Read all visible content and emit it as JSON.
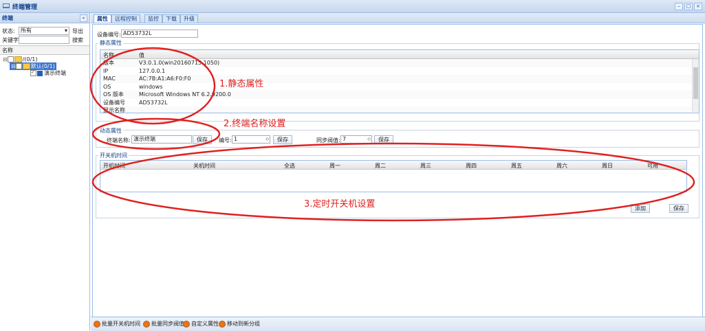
{
  "window": {
    "title": "终端管理",
    "buttons": [
      "–",
      "□",
      "×"
    ]
  },
  "left_panel": {
    "title": "终端",
    "status_label": "状态:",
    "status_value": "所有",
    "export_label": "导出",
    "keyword_label": "关键字:",
    "keyword_value": "",
    "search_label": "搜索",
    "tree_header": "名称",
    "tree_root": "/(0/1)",
    "tree_selected": "默认(0/1)",
    "tree_leaf": "演示终端"
  },
  "tabs": [
    "属性",
    "远程控制",
    "监控",
    "下载",
    "升级"
  ],
  "device": {
    "id_label": "设备编号:",
    "id_value": "AD53732L"
  },
  "static_props": {
    "legend": "静态属性",
    "col_name": "名称",
    "col_value": "值",
    "rows": [
      {
        "name": "版本",
        "value": "V3.0.1.0(win20160715.1050)"
      },
      {
        "name": "IP",
        "value": "127.0.0.1"
      },
      {
        "name": "MAC",
        "value": "AC:7B:A1:A6:F0:F0"
      },
      {
        "name": "OS",
        "value": "windows"
      },
      {
        "name": "OS 版本",
        "value": "Microsoft Windows NT 6.2.9200.0"
      },
      {
        "name": "设备编号",
        "value": "AD53732L"
      }
    ],
    "partial_row": "显示名称"
  },
  "dynamic_props": {
    "legend": "动态属性",
    "name_label": "终端名称:",
    "name_value": "演示终端",
    "save1": "保存",
    "num_label": "编号:",
    "num_value": "1",
    "save2": "保存",
    "sync_label": "同步阀值:",
    "sync_value": "7",
    "save3": "保存"
  },
  "schedule": {
    "legend": "开关机时间",
    "columns": [
      "开机时间",
      "关机时间",
      "全选",
      "周一",
      "周二",
      "周三",
      "周四",
      "周五",
      "周六",
      "周日",
      "可用"
    ],
    "add_label": "添加",
    "save_label": "保存"
  },
  "annotations": {
    "a1": "1.静态属性",
    "a2": "2.终端名称设置",
    "a3": "3.定时开关机设置",
    "color": "#e02020"
  },
  "bottom_actions": [
    "批量开关机时间",
    "批量同步阀值",
    "自定义属性",
    "移动到新分组"
  ]
}
